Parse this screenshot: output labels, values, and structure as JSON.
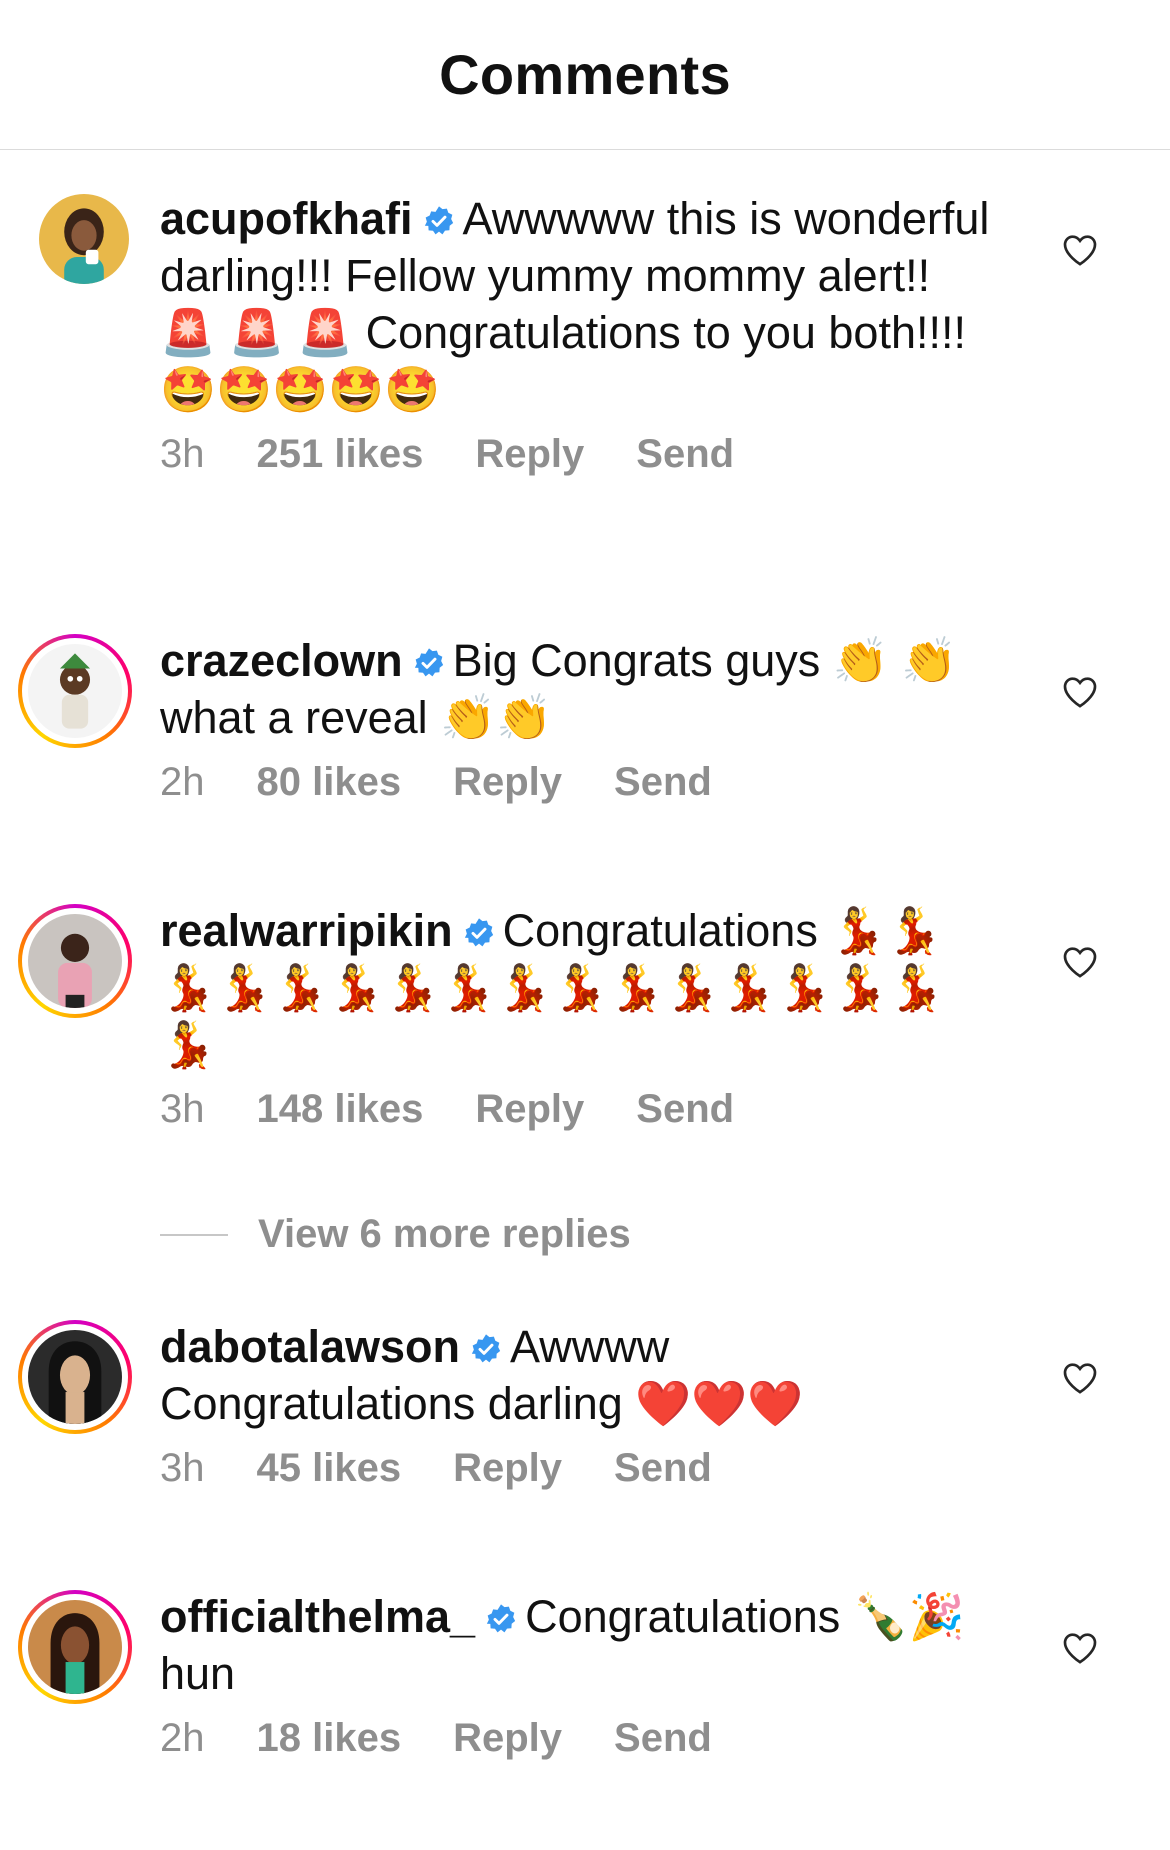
{
  "header": {
    "title": "Comments"
  },
  "comments": [
    {
      "username": "acupofkhafi",
      "text": "Awwwww this is wonderful darling!!! Fellow yummy mommy alert!! 🚨 🚨 🚨 Congratulations to you both!!!! 🤩🤩🤩🤩🤩",
      "time": "3h",
      "likes": "251 likes",
      "reply": "Reply",
      "send": "Send"
    },
    {
      "username": "crazeclown",
      "text": "Big Congrats guys 👏 👏 what a reveal 👏👏",
      "time": "2h",
      "likes": "80 likes",
      "reply": "Reply",
      "send": "Send"
    },
    {
      "username": "realwarripikin",
      "text": "Congratulations 💃💃💃💃💃💃💃💃💃💃💃💃💃💃💃💃💃",
      "time": "3h",
      "likes": "148 likes",
      "reply": "Reply",
      "send": "Send"
    },
    {
      "username": "dabotalawson",
      "text": "Awwww Congratulations darling ❤️❤️❤️",
      "time": "3h",
      "likes": "45 likes",
      "reply": "Reply",
      "send": "Send"
    },
    {
      "username": "officialthelma_",
      "text": "Congratulations 🍾🎉 hun",
      "time": "2h",
      "likes": "18 likes",
      "reply": "Reply",
      "send": "Send"
    }
  ],
  "view_more_replies": "View 6 more replies",
  "colors": {
    "verified": "#3897f0",
    "muted": "#8e8e8e",
    "divider": "#dbdbdb"
  },
  "icons": {
    "verified": "verified-badge-icon",
    "like": "heart-outline-icon"
  }
}
